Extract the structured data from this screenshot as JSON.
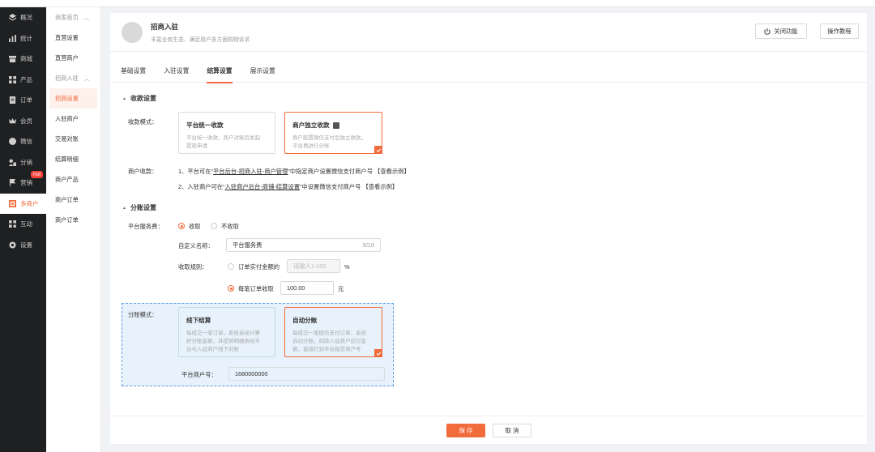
{
  "nav": [
    {
      "label": "概况",
      "icon": "layers-icon"
    },
    {
      "label": "统计",
      "icon": "chart-icon"
    },
    {
      "label": "商城",
      "icon": "store-icon"
    },
    {
      "label": "产品",
      "icon": "grid-icon"
    },
    {
      "label": "订单",
      "icon": "order-icon"
    },
    {
      "label": "会员",
      "icon": "crown-icon"
    },
    {
      "label": "微信",
      "icon": "wechat-icon"
    },
    {
      "label": "分销",
      "icon": "distribution-icon"
    },
    {
      "label": "营销",
      "icon": "flag-icon",
      "badge": "hot"
    },
    {
      "label": "多商户",
      "icon": "multi-merchant-icon",
      "active": true
    },
    {
      "label": "互动",
      "icon": "interact-icon"
    },
    {
      "label": "设置",
      "icon": "gear-icon"
    }
  ],
  "submenu": {
    "group1": "商家首页",
    "group1_items": [
      "直营设置",
      "直营商户"
    ],
    "group2": "招商入驻",
    "group2_items": [
      "招商设置",
      "入驻商户",
      "交易对账",
      "结算明细",
      "商户产品",
      "商户订单",
      "商户订单"
    ]
  },
  "header": {
    "title": "招商入驻",
    "subtitle": "丰富业务生态、满足用户多方面购物诉求",
    "close_btn": "关闭功能",
    "tutorial_btn": "操作教程"
  },
  "tabs": [
    "基础设置",
    "入驻设置",
    "结算设置",
    "展示设置"
  ],
  "collect": {
    "section_title": "收款设置",
    "mode_label": "收款模式：",
    "option1_title": "平台统一收款",
    "option1_desc1": "平台统一收款，商户对账后发起",
    "option1_desc2": "提现申请",
    "option2_title": "商户独立收款",
    "option2_desc1": "商户配置微信支付后独立收款，",
    "option2_desc2": "平台再进行分账",
    "merchant_label": "商户收款：",
    "line1_prefix": "1、平台可在“",
    "line1_link": "平台后台-招商入驻-商户管理",
    "line1_suffix": "”中指定商户设置微信支付商户号",
    "line1_example": "【查看示例】",
    "line2_prefix": "2、入驻商户可在“",
    "line2_link": "入驻商户后台-商铺-结算设置",
    "line2_suffix": "”中设置微信支付商户号",
    "line2_example": "【查看示例】"
  },
  "split": {
    "section_title": "分账设置",
    "fee_label": "平台服务费：",
    "fee_on": "收取",
    "fee_off": "不收取",
    "custom_name_label": "自定义名称：",
    "custom_name_value": "平台服务费",
    "custom_name_count": "5/10",
    "rule_label": "收取规则：",
    "rule1_label": "订单实付金额的",
    "rule1_placeholder": "请输入1-100",
    "rule1_unit": "%",
    "rule2_label": "每笔订单收取",
    "rule2_value": "100.00",
    "rule2_unit": "元",
    "mode_label": "分账模式：",
    "opt1_title": "线下结算",
    "opt1_desc1": "每成交一笔订单，系统自动计算",
    "opt1_desc2": "好分账金额，并提供明细表给平",
    "opt1_desc3": "台与入驻商户线下对账",
    "opt2_title": "自动分账",
    "opt2_desc1": "每成交一笔微信支付订单，系统",
    "opt2_desc2": "自动分账，扣除入驻商户应付金",
    "opt2_desc3": "额，直接打到平台指定商户号",
    "merchant_no_label": "平台商户号：",
    "merchant_no_value": "1680000000"
  },
  "footer": {
    "save": "保 存",
    "cancel": "取 消"
  },
  "colors": {
    "accent": "#f26b3a",
    "nav_bg": "#1f2022",
    "split_bg": "#e8f2fc",
    "split_border": "#5a9ee6"
  }
}
